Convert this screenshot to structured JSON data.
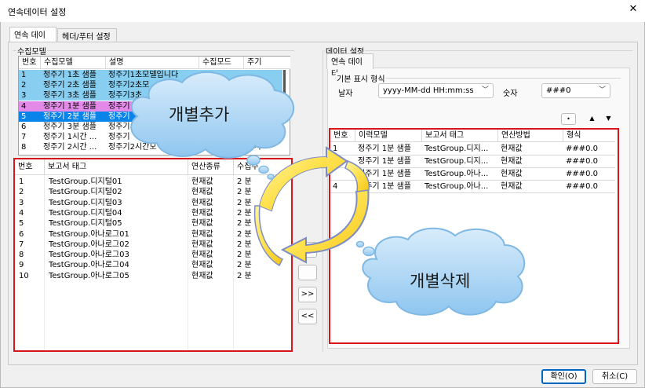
{
  "window": {
    "title": "연속데이터 설정",
    "close_glyph": "✕"
  },
  "tabs": [
    {
      "label": "연속 데이터"
    },
    {
      "label": "헤더/푸터 설정"
    }
  ],
  "collection_models": {
    "group_label": "수집모델",
    "columns": [
      "번호",
      "수집모델",
      "설명",
      "수집모드",
      "주기"
    ],
    "rows": [
      {
        "no": "1",
        "model": "정주기 1초 샘플",
        "desc": "정주기1초모델입니다",
        "mode": "",
        "period": "",
        "style": "sel-blue"
      },
      {
        "no": "2",
        "model": "정주기 2초 샘플",
        "desc": "정주기2초모",
        "mode": "",
        "period": "",
        "style": "sel-blue"
      },
      {
        "no": "3",
        "model": "정주기 3초 샘플",
        "desc": "정주기3초",
        "mode": "",
        "period": "",
        "style": "sel-blue"
      },
      {
        "no": "4",
        "model": "정주기 1분 샘플",
        "desc": "정주기",
        "mode": "",
        "period": "",
        "style": "sel-pink"
      },
      {
        "no": "5",
        "model": "정주기 2분 샘플",
        "desc": "정주기",
        "mode": "",
        "period": "",
        "style": "sel-active"
      },
      {
        "no": "6",
        "model": "정주기 3분 샘플",
        "desc": "정주기",
        "mode": "",
        "period": "",
        "style": "plain"
      },
      {
        "no": "7",
        "model": "정주기 1시간 ...",
        "desc": "정주기",
        "mode": "",
        "period": "",
        "style": "plain"
      },
      {
        "no": "8",
        "model": "정주기 2시간 ...",
        "desc": "정주기2시간모",
        "mode": "",
        "period": "2 시",
        "style": "plain"
      }
    ]
  },
  "report_tags": {
    "columns": [
      "번호",
      "보고서 태그",
      "연산종류",
      "수집주"
    ],
    "rows": [
      {
        "no": "1",
        "tag": "TestGroup.디지털01",
        "op": "현재값",
        "period": "2 분"
      },
      {
        "no": "2",
        "tag": "TestGroup.디지털02",
        "op": "현재값",
        "period": "2 분"
      },
      {
        "no": "3",
        "tag": "TestGroup.디지털03",
        "op": "현재값",
        "period": "2 분"
      },
      {
        "no": "4",
        "tag": "TestGroup.디지털04",
        "op": "현재값",
        "period": "2 분"
      },
      {
        "no": "5",
        "tag": "TestGroup.디지털05",
        "op": "현재값",
        "period": "2 분"
      },
      {
        "no": "6",
        "tag": "TestGroup.아나로그01",
        "op": "현재값",
        "period": "2 분"
      },
      {
        "no": "7",
        "tag": "TestGroup.아나로그02",
        "op": "현재값",
        "period": "2 분"
      },
      {
        "no": "8",
        "tag": "TestGroup.아나로그03",
        "op": "현재값",
        "period": "2 분"
      },
      {
        "no": "9",
        "tag": "TestGroup.아나로그04",
        "op": "현재값",
        "period": "2 분"
      },
      {
        "no": "10",
        "tag": "TestGroup.아나로그05",
        "op": "현재값",
        "period": "2 분"
      }
    ]
  },
  "transfer_buttons": [
    {
      "label": ">"
    },
    {
      "label": ""
    },
    {
      "label": ">>"
    },
    {
      "label": "<<"
    }
  ],
  "data_settings": {
    "group_label": "데이터 설정",
    "subtab_label": "연속 데이터",
    "format_group_label": "기본 표시 형식",
    "date_label": "날자",
    "date_value": "yyyy-MM-dd HH:mm:ss",
    "number_label": "숫자",
    "number_value": "###0",
    "small_buttons": [
      {
        "label": "•"
      },
      {
        "label": "▲"
      },
      {
        "label": "▼"
      }
    ]
  },
  "selected_data": {
    "columns": [
      "번호",
      "이력모델",
      "보고서 태그",
      "연산방법",
      "형식"
    ],
    "rows": [
      {
        "no": "1",
        "model": "정주기 1분 샘플",
        "tag": "TestGroup.디지...",
        "op": "현재값",
        "fmt": "###0.0"
      },
      {
        "no": "",
        "model": "정주기 1분 샘플",
        "tag": "TestGroup.디지...",
        "op": "현재값",
        "fmt": "###0.0"
      },
      {
        "no": "",
        "model": "정주기 1분 샘플",
        "tag": "TestGroup.아나...",
        "op": "현재값",
        "fmt": "###0.0"
      },
      {
        "no": "4",
        "model": "정주기 1분 샘플",
        "tag": "TestGroup.아나...",
        "op": "현재값",
        "fmt": "###0.0"
      }
    ]
  },
  "callouts": {
    "add": "개별추가",
    "delete": "개별삭제"
  },
  "footer": {
    "ok_label": "확인(O)",
    "cancel_label": "취소(C)"
  },
  "colors": {
    "sel_blue": "#87cef0",
    "sel_pink": "#e38ae8",
    "sel_active": "#0a84e8",
    "highlight_red": "#d9151b",
    "cloud_fill": "#a9d4f5",
    "cloud_stroke": "#7fb8e3",
    "arrow_fill": "#ffe14d",
    "arrow_stroke": "#7d8cc4",
    "accent": "#0067c0"
  }
}
